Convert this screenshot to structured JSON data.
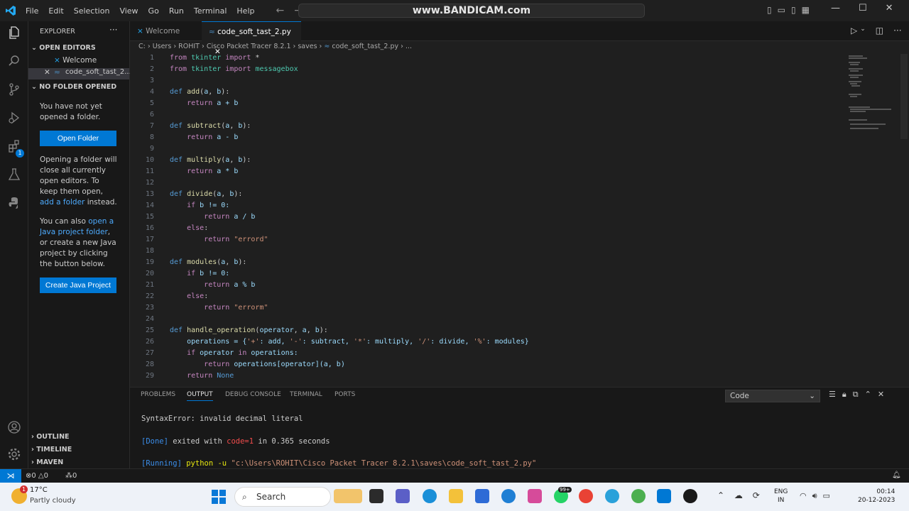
{
  "titlebar": {
    "menu": [
      "File",
      "Edit",
      "Selection",
      "View",
      "Go",
      "Run",
      "Terminal",
      "Help"
    ],
    "command_center": "www.BANDICAM.com"
  },
  "sidebar": {
    "header": "EXPLORER",
    "open_editors_title": "OPEN EDITORS",
    "open_editors": [
      {
        "label": "Welcome"
      },
      {
        "label": "code_soft_tast_2..."
      }
    ],
    "no_folder_title": "NO FOLDER OPENED",
    "msg1": "You have not yet opened a folder.",
    "open_folder_button": "Open Folder",
    "msg2_a": "Opening a folder will close all currently open editors. To keep them open, ",
    "msg2_link": "add a folder",
    "msg2_b": " instead.",
    "msg3_a": "You can also ",
    "msg3_link": "open a Java project folder",
    "msg3_b": ", or create a new Java project by clicking the button below.",
    "create_java_button": "Create Java Project",
    "outline": "OUTLINE",
    "timeline": "TIMELINE",
    "maven": "MAVEN"
  },
  "tabs": [
    {
      "label": "Welcome"
    },
    {
      "label": "code_soft_tast_2.py"
    }
  ],
  "breadcrumb": [
    "C:",
    "Users",
    "ROHIT",
    "Cisco Packet Tracer 8.2.1",
    "saves",
    "code_soft_tast_2.py",
    "..."
  ],
  "code_lines": [
    {
      "n": "1"
    },
    {
      "n": "2"
    },
    {
      "n": "3"
    },
    {
      "n": "4"
    },
    {
      "n": "5"
    },
    {
      "n": "6"
    },
    {
      "n": "7"
    },
    {
      "n": "8"
    },
    {
      "n": "9"
    },
    {
      "n": "10"
    },
    {
      "n": "11"
    },
    {
      "n": "12"
    },
    {
      "n": "13"
    },
    {
      "n": "14"
    },
    {
      "n": "15"
    },
    {
      "n": "16"
    },
    {
      "n": "17"
    },
    {
      "n": "18"
    },
    {
      "n": "19"
    },
    {
      "n": "20"
    },
    {
      "n": "21"
    },
    {
      "n": "22"
    },
    {
      "n": "23"
    },
    {
      "n": "24"
    },
    {
      "n": "25"
    },
    {
      "n": "26"
    },
    {
      "n": "27"
    },
    {
      "n": "28"
    },
    {
      "n": "29"
    }
  ],
  "code": {
    "l1": [
      "from",
      " tkinter ",
      "import",
      " *"
    ],
    "l2": [
      "from",
      " tkinter ",
      "import",
      " messagebox"
    ],
    "l4": [
      "def",
      " ",
      "add",
      "(",
      "a",
      ", ",
      "b",
      "):"
    ],
    "l5": [
      "    ",
      "return",
      " a + b"
    ],
    "l7": [
      "def",
      " ",
      "subtract",
      "(",
      "a",
      ", ",
      "b",
      "):"
    ],
    "l8": [
      "    ",
      "return",
      " a - b"
    ],
    "l10": [
      "def",
      " ",
      "multiply",
      "(",
      "a",
      ", ",
      "b",
      "):"
    ],
    "l11": [
      "    ",
      "return",
      " a * b"
    ],
    "l13": [
      "def",
      " ",
      "divide",
      "(",
      "a",
      ", ",
      "b",
      "):"
    ],
    "l14": [
      "    ",
      "if",
      " b != 0:"
    ],
    "l15": [
      "        ",
      "return",
      " a / b"
    ],
    "l16": [
      "    ",
      "else",
      ":"
    ],
    "l17": [
      "        ",
      "return",
      " ",
      "\"errord\""
    ],
    "l19": [
      "def",
      " ",
      "modules",
      "(",
      "a",
      ", ",
      "b",
      "):"
    ],
    "l20": [
      "    ",
      "if",
      " b != 0:"
    ],
    "l21": [
      "        ",
      "return",
      " a % b"
    ],
    "l22": [
      "    ",
      "else",
      ":"
    ],
    "l23": [
      "        ",
      "return",
      " ",
      "\"errorm\""
    ],
    "l25": [
      "def",
      " ",
      "handle_operation",
      "(",
      "operator",
      ", ",
      "a",
      ", ",
      "b",
      "):"
    ],
    "l26": [
      "    operations = {",
      "'+'",
      ": add, ",
      "'-'",
      ": subtract, ",
      "'*'",
      ": multiply, ",
      "'/'",
      ": divide, ",
      "'%'",
      ": modules}"
    ],
    "l27": [
      "    ",
      "if",
      " operator ",
      "in",
      " operations:"
    ],
    "l28": [
      "        ",
      "return",
      " operations[operator](a, b)"
    ],
    "l29": [
      "    ",
      "return",
      " ",
      "None"
    ]
  },
  "panel": {
    "tabs": [
      "PROBLEMS",
      "OUTPUT",
      "DEBUG CONSOLE",
      "TERMINAL",
      "PORTS"
    ],
    "active_tab": "OUTPUT",
    "channel": "Code",
    "lines": {
      "error": "SyntaxError: invalid decimal literal",
      "done_tag": "[Done]",
      "done_text_a": " exited with ",
      "done_code": "code=1",
      "done_text_b": " in ",
      "done_time": "0.365",
      "done_text_c": " seconds",
      "run_tag": "[Running]",
      "run_cmd": " python -u ",
      "run_path": "\"c:\\Users\\ROHIT\\Cisco Packet Tracer 8.2.1\\saves\\code_soft_tast_2.py\""
    }
  },
  "status": {
    "errors": "⊗0 △0",
    "ports": "⁂0"
  },
  "taskbar": {
    "weather_temp": "17°C",
    "weather_desc": "Partly cloudy",
    "weather_badge": "1",
    "search": "Search",
    "lang_top": "ENG",
    "lang_bottom": "IN",
    "time": "00:14",
    "date": "20-12-2023",
    "whatsapp_badge": "99+"
  },
  "colors": {
    "accent": "#0078d4",
    "editor_bg": "#1f1f1f",
    "taskbar_bg": "#eef2f8"
  }
}
